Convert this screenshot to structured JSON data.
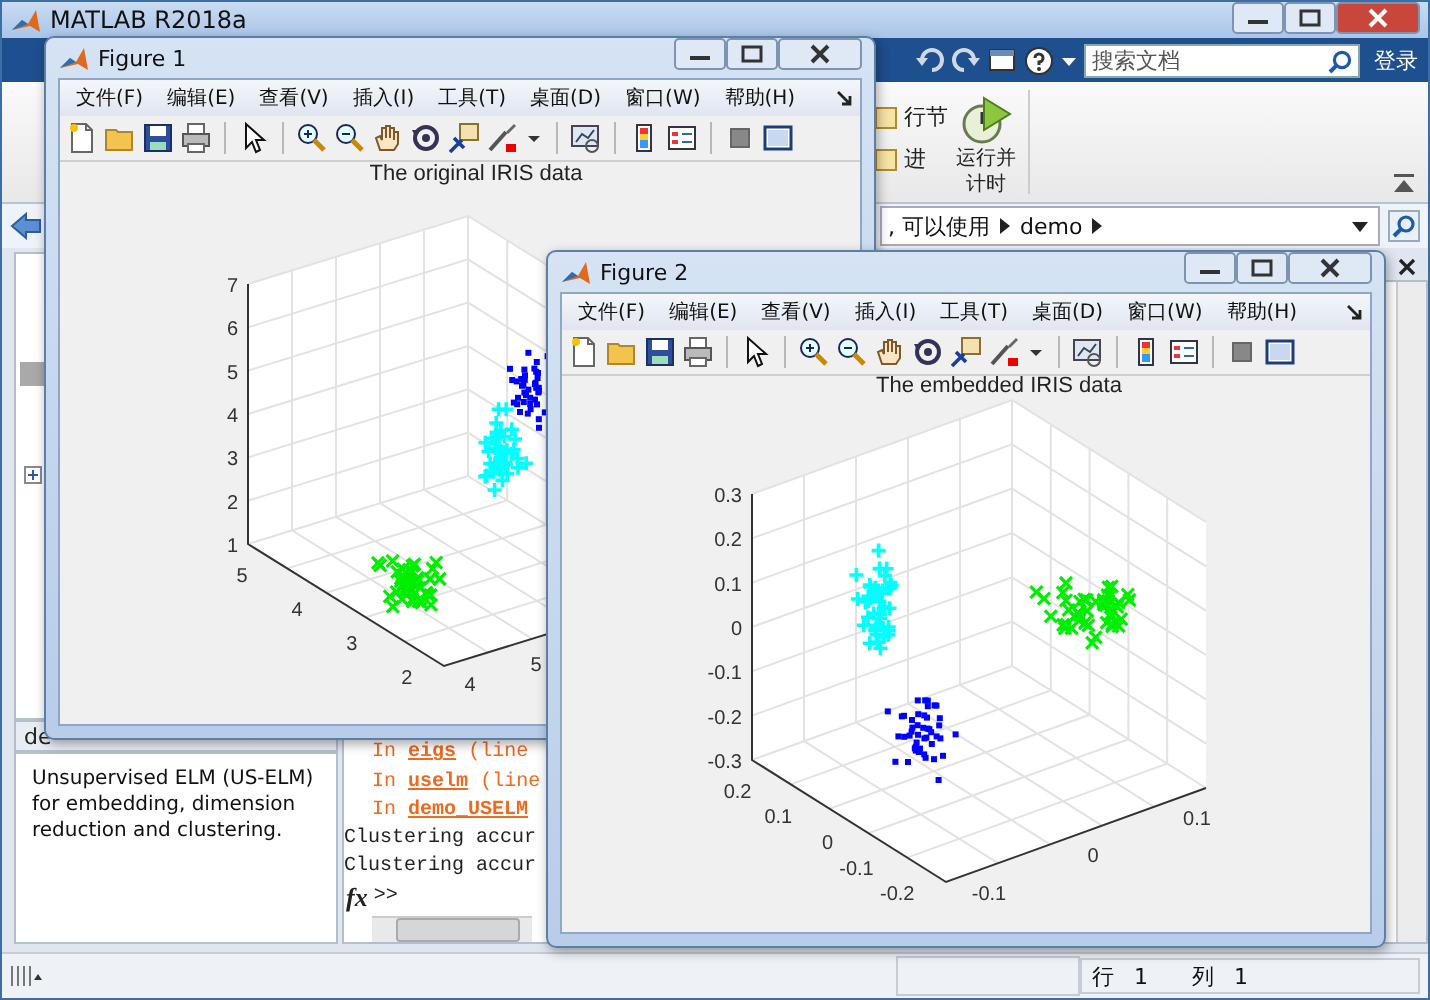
{
  "window": {
    "title": "MATLAB R2018a"
  },
  "toolstrip": {
    "search": {
      "placeholder": "搜索文档"
    },
    "sign_in": "登录",
    "ribbon_items": [
      {
        "label": "行节"
      },
      {
        "label": "进"
      },
      {
        "label": "运行并计时"
      }
    ]
  },
  "address_bar": {
    "path": [
      ", 可以使用",
      "demo"
    ]
  },
  "details": {
    "tab_label": "de",
    "description": "Unsupervised ELM (US-ELM) for embedding, dimension reduction and clustering."
  },
  "command_window": {
    "lines": [
      {
        "kind": "warning",
        "prefix": "In",
        "func": "eigs",
        "rest": "(line"
      },
      {
        "kind": "warning",
        "prefix": "In",
        "func": "uselm",
        "rest": "(line"
      },
      {
        "kind": "warning",
        "prefix": "In",
        "func": "demo_USELM"
      },
      {
        "kind": "output",
        "text": "Clustering accur"
      },
      {
        "kind": "output",
        "text": "Clustering accur"
      }
    ],
    "function_button": "fx",
    "prompt": ">>"
  },
  "status_bar": {
    "row_label": "行",
    "row": "1",
    "col_label": "列",
    "col": "1"
  },
  "figures": [
    {
      "title": "Figure 1",
      "menu": [
        "文件(F)",
        "编辑(E)",
        "查看(V)",
        "插入(I)",
        "工具(T)",
        "桌面(D)",
        "窗口(W)",
        "帮助(H)"
      ],
      "plot": {
        "title": "The original IRIS data",
        "z_ticks": [
          "7",
          "6",
          "5",
          "4",
          "3",
          "2",
          "1"
        ],
        "y_ticks": [
          "5",
          "4",
          "3",
          "2"
        ],
        "x_ticks": [
          "4",
          "5"
        ]
      }
    },
    {
      "title": "Figure 2",
      "menu": [
        "文件(F)",
        "编辑(E)",
        "查看(V)",
        "插入(I)",
        "工具(T)",
        "桌面(D)",
        "窗口(W)",
        "帮助(H)"
      ],
      "plot": {
        "title": "The embedded IRIS data",
        "z_ticks": [
          "0.3",
          "0.2",
          "0.1",
          "0",
          "-0.1",
          "-0.2",
          "-0.3"
        ],
        "y_ticks": [
          "0.2",
          "0.1",
          "0",
          "-0.1",
          "-0.2"
        ],
        "x_ticks": [
          "-0.1",
          "0",
          "0.1"
        ]
      }
    }
  ]
}
